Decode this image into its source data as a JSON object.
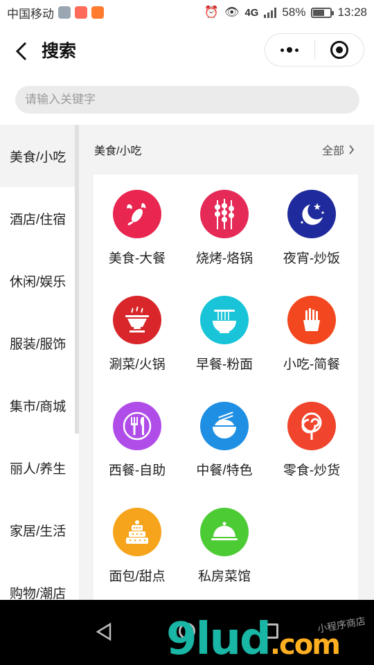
{
  "status_bar": {
    "carrier": "中国移动",
    "network": "4G",
    "network_small": "4G",
    "battery": "58%",
    "battery_fraction": 0.58,
    "time": "13:28"
  },
  "nav": {
    "title": "搜索",
    "back_icon": "chevron-left-icon",
    "more_icon": "more-dots-icon",
    "close_icon": "target-icon"
  },
  "search": {
    "placeholder": "请输入关键字"
  },
  "sidebar": {
    "items": [
      {
        "label": "美食/小吃",
        "active": true
      },
      {
        "label": "酒店/住宿"
      },
      {
        "label": "休闲/娱乐"
      },
      {
        "label": "服装/服饰"
      },
      {
        "label": "集市/商城"
      },
      {
        "label": "丽人/养生"
      },
      {
        "label": "家居/生活"
      },
      {
        "label": "购物/潮店"
      }
    ]
  },
  "content": {
    "section_title": "美食/小吃",
    "all_label": "全部",
    "categories": [
      {
        "label": "美食-大餐",
        "icon": "lobster-icon",
        "color": "#e8264f"
      },
      {
        "label": "烧烤-烙锅",
        "icon": "skewers-icon",
        "color": "#e52a58"
      },
      {
        "label": "夜宵-炒饭",
        "icon": "moon-stars-icon",
        "color": "#1f2a9c"
      },
      {
        "label": "涮菜/火锅",
        "icon": "hotpot-icon",
        "color": "#d8262a"
      },
      {
        "label": "早餐-粉面",
        "icon": "noodle-bowl-icon",
        "color": "#19c4d8"
      },
      {
        "label": "小吃-简餐",
        "icon": "fries-icon",
        "color": "#f2471f"
      },
      {
        "label": "西餐-自助",
        "icon": "fork-knife-icon",
        "color": "#b04de8"
      },
      {
        "label": "中餐/特色",
        "icon": "rice-bowl-icon",
        "color": "#1e8fe3"
      },
      {
        "label": "零食-炒货",
        "icon": "lollipop-icon",
        "color": "#f0442c"
      },
      {
        "label": "面包/甜点",
        "icon": "cake-icon",
        "color": "#f6a41c"
      },
      {
        "label": "私房菜馆",
        "icon": "cloche-icon",
        "color": "#4ccb34"
      }
    ]
  },
  "watermark": {
    "brand": "9lud",
    "tld": ".com",
    "tagline": "小程序商店"
  }
}
